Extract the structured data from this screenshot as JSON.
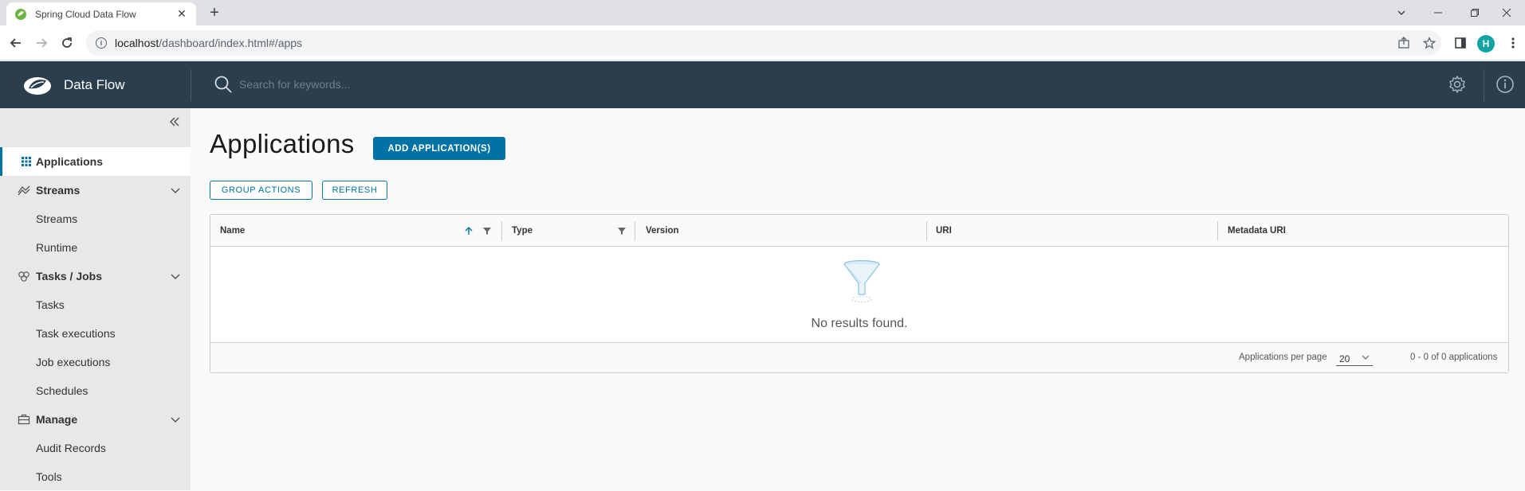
{
  "browser": {
    "tab_title": "Spring Cloud Data Flow",
    "url_host": "localhost",
    "url_path": "/dashboard/index.html#/apps",
    "profile_initial": "H"
  },
  "header": {
    "brand": "Data Flow",
    "search_placeholder": "Search for keywords..."
  },
  "sidebar": {
    "items": [
      {
        "label": "Applications"
      },
      {
        "label": "Streams"
      },
      {
        "label": "Streams"
      },
      {
        "label": "Runtime"
      },
      {
        "label": "Tasks / Jobs"
      },
      {
        "label": "Tasks"
      },
      {
        "label": "Task executions"
      },
      {
        "label": "Job executions"
      },
      {
        "label": "Schedules"
      },
      {
        "label": "Manage"
      },
      {
        "label": "Audit Records"
      },
      {
        "label": "Tools"
      }
    ]
  },
  "main": {
    "title": "Applications",
    "add_button": "ADD APPLICATION(S)",
    "group_actions": "GROUP ACTIONS",
    "refresh": "REFRESH",
    "columns": [
      "Name",
      "Type",
      "Version",
      "URI",
      "Metadata URI"
    ],
    "empty_message": "No results found.",
    "per_page_label": "Applications per page",
    "per_page_value": "20",
    "count_text": "0 - 0 of 0 applications"
  },
  "colors": {
    "header_bg": "#2b3e4e",
    "accent": "#0072a3",
    "sidebar_bg": "#e8e8e8"
  }
}
